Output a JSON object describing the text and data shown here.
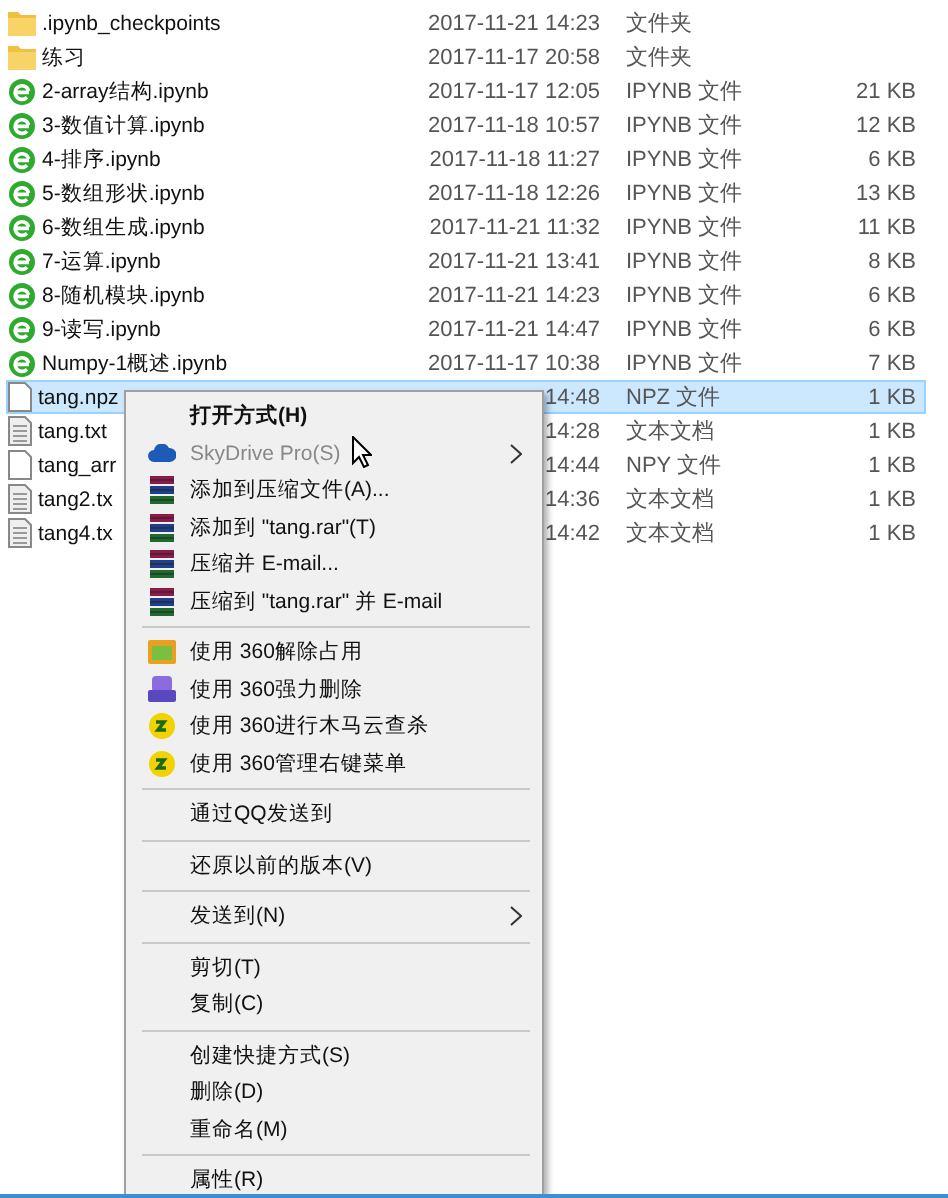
{
  "files": [
    {
      "name": ".ipynb_checkpoints",
      "modified": "2017-11-21 14:23",
      "type": "文件夹",
      "kind": "folder",
      "selected": false
    },
    {
      "name": "练习",
      "modified": "2017-11-17 20:58",
      "type": "文件夹",
      "kind": "folder",
      "selected": false
    },
    {
      "name": "2-array结构.ipynb",
      "modified": "2017-11-17 12:05",
      "type": "IPYNB 文件",
      "size": "21 KB",
      "kind": "notebook",
      "selected": false
    },
    {
      "name": "3-数值计算.ipynb",
      "modified": "2017-11-18 10:57",
      "type": "IPYNB 文件",
      "size": "12 KB",
      "kind": "notebook",
      "selected": false
    },
    {
      "name": "4-排序.ipynb",
      "modified": "2017-11-18 11:27",
      "type": "IPYNB 文件",
      "size": "6 KB",
      "kind": "notebook",
      "selected": false
    },
    {
      "name": "5-数组形状.ipynb",
      "modified": "2017-11-18 12:26",
      "type": "IPYNB 文件",
      "size": "13 KB",
      "kind": "notebook",
      "selected": false
    },
    {
      "name": "6-数组生成.ipynb",
      "modified": "2017-11-21 11:32",
      "type": "IPYNB 文件",
      "size": "11 KB",
      "kind": "notebook",
      "selected": false
    },
    {
      "name": "7-运算.ipynb",
      "modified": "2017-11-21 13:41",
      "type": "IPYNB 文件",
      "size": "8 KB",
      "kind": "notebook",
      "selected": false
    },
    {
      "name": "8-随机模块.ipynb",
      "modified": "2017-11-21 14:23",
      "type": "IPYNB 文件",
      "size": "6 KB",
      "kind": "notebook",
      "selected": false
    },
    {
      "name": "9-读写.ipynb",
      "modified": "2017-11-21 14:47",
      "type": "IPYNB 文件",
      "size": "6 KB",
      "kind": "notebook",
      "selected": false
    },
    {
      "name": "Numpy-1概述.ipynb",
      "modified": "2017-11-17 10:38",
      "type": "IPYNB 文件",
      "size": "7 KB",
      "kind": "notebook",
      "selected": false
    },
    {
      "name": "tang.npz",
      "modified": "14:48",
      "type": "NPZ 文件",
      "size": "1 KB",
      "kind": "file",
      "selected": true
    },
    {
      "name": "tang.txt",
      "modified": "14:28",
      "type": "文本文档",
      "size": "1 KB",
      "kind": "text",
      "selected": false
    },
    {
      "name": "tang_arr",
      "modified": "14:44",
      "type": "NPY 文件",
      "size": "1 KB",
      "kind": "file",
      "selected": false
    },
    {
      "name": "tang2.tx",
      "modified": "14:36",
      "type": "文本文档",
      "size": "1 KB",
      "kind": "text",
      "selected": false
    },
    {
      "name": "tang4.tx",
      "modified": "14:42",
      "type": "文本文档",
      "size": "1 KB",
      "kind": "text",
      "selected": false
    }
  ],
  "context_menu": [
    {
      "kind": "item",
      "label": "打开方式(H)",
      "bold": true,
      "disabled": false,
      "submenu": false
    },
    {
      "kind": "item",
      "label": "SkyDrive Pro(S)",
      "bold": false,
      "disabled": true,
      "submenu": true
    },
    {
      "kind": "item",
      "label": "添加到压缩文件(A)...",
      "bold": false,
      "disabled": false,
      "submenu": false
    },
    {
      "kind": "item",
      "label": "添加到 \"tang.rar\"(T)",
      "bold": false,
      "disabled": false,
      "submenu": false
    },
    {
      "kind": "item",
      "label": "压缩并 E-mail...",
      "bold": false,
      "disabled": false,
      "submenu": false
    },
    {
      "kind": "item",
      "label": "压缩到 \"tang.rar\" 并 E-mail",
      "bold": false,
      "disabled": false,
      "submenu": false
    },
    {
      "kind": "separator"
    },
    {
      "kind": "item",
      "label": "使用 360解除占用",
      "bold": false,
      "disabled": false,
      "submenu": false
    },
    {
      "kind": "item",
      "label": "使用 360强力删除",
      "bold": false,
      "disabled": false,
      "submenu": false
    },
    {
      "kind": "item",
      "label": "使用 360进行木马云查杀",
      "bold": false,
      "disabled": false,
      "submenu": false
    },
    {
      "kind": "item",
      "label": "使用 360管理右键菜单",
      "bold": false,
      "disabled": false,
      "submenu": false
    },
    {
      "kind": "separator"
    },
    {
      "kind": "item",
      "label": "通过QQ发送到",
      "bold": false,
      "disabled": false,
      "submenu": false
    },
    {
      "kind": "separator"
    },
    {
      "kind": "item",
      "label": "还原以前的版本(V)",
      "bold": false,
      "disabled": false,
      "submenu": false
    },
    {
      "kind": "separator"
    },
    {
      "kind": "item",
      "label": "发送到(N)",
      "bold": false,
      "disabled": false,
      "submenu": true
    },
    {
      "kind": "separator"
    },
    {
      "kind": "item",
      "label": "剪切(T)",
      "bold": false,
      "disabled": false,
      "submenu": false
    },
    {
      "kind": "item",
      "label": "复制(C)",
      "bold": false,
      "disabled": false,
      "submenu": false
    },
    {
      "kind": "separator"
    },
    {
      "kind": "item",
      "label": "创建快捷方式(S)",
      "bold": false,
      "disabled": false,
      "submenu": false
    },
    {
      "kind": "item",
      "label": "删除(D)",
      "bold": false,
      "disabled": false,
      "submenu": false
    },
    {
      "kind": "item",
      "label": "重命名(M)",
      "bold": false,
      "disabled": false,
      "submenu": false
    },
    {
      "kind": "separator"
    },
    {
      "kind": "item",
      "label": "属性(R)",
      "bold": false,
      "disabled": false,
      "submenu": false
    }
  ]
}
